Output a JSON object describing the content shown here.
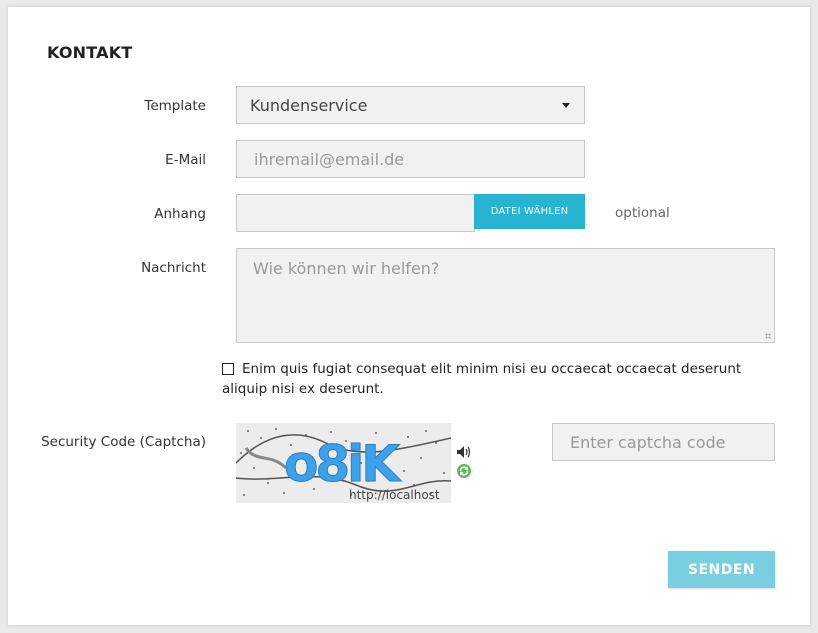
{
  "form": {
    "title": "KONTAKT",
    "template": {
      "label": "Template",
      "value": "Kundenservice"
    },
    "email": {
      "label": "E-Mail",
      "placeholder": "ihremail@email.de"
    },
    "attachment": {
      "label": "Anhang",
      "button_label": "DATEI WÄHLEN",
      "note": "optional"
    },
    "message": {
      "label": "Nachricht",
      "placeholder": "Wie können wir helfen?"
    },
    "consent": {
      "checked": false,
      "text": "Enim quis fugiat consequat elit minim nisi eu occaecat occaecat deserunt aliquip nisi ex deserunt."
    },
    "captcha": {
      "label": "Security Code (Captcha)",
      "image_text": "o8iK",
      "image_caption": "http://localhost",
      "input_placeholder": "Enter captcha code",
      "audio_icon": "speaker-icon",
      "refresh_icon": "refresh-icon"
    },
    "submit_label": "SENDEN"
  },
  "colors": {
    "accent": "#27b4d3",
    "submit": "#78cfe0",
    "captcha_text": "#3da0e8",
    "field_bg": "#f1f1f1"
  }
}
